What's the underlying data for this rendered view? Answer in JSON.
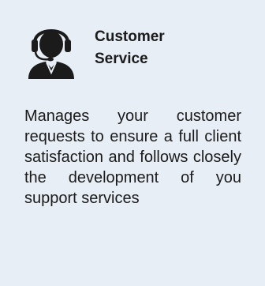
{
  "card": {
    "icon": "customer-service-headset-icon",
    "title_line1": "Customer",
    "title_line2": "Service",
    "description": "Manages your customer requests to ensure a full client satisfaction and follows closely the development of you support services"
  },
  "colors": {
    "background": "#e7eef5",
    "icon": "#1b1b1b",
    "text": "#1b1b1b"
  }
}
